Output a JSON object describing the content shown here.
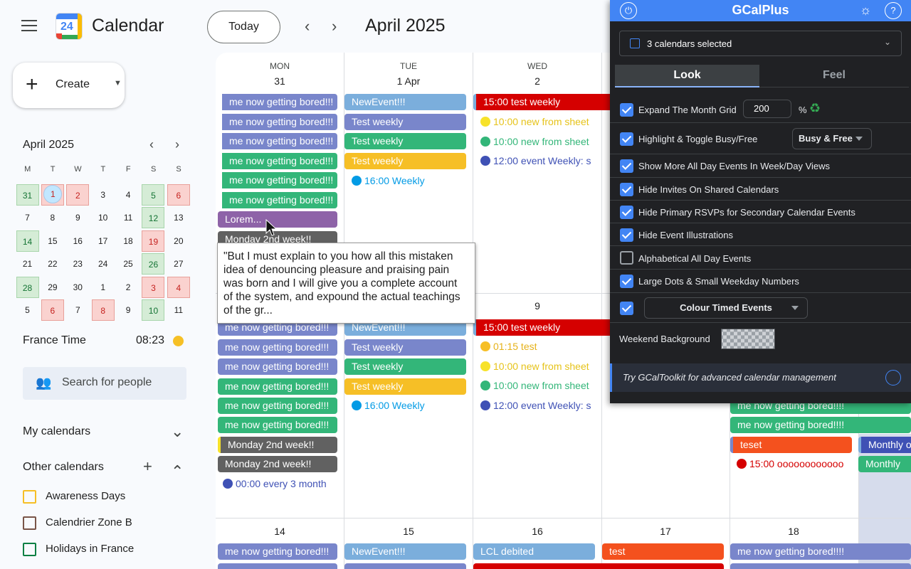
{
  "header": {
    "app_title": "Calendar",
    "logo_number": "24",
    "today_label": "Today",
    "month_title": "April 2025"
  },
  "sidebar": {
    "create_label": "Create",
    "mini_month": "April 2025",
    "dow": [
      "M",
      "T",
      "W",
      "T",
      "F",
      "S",
      "S"
    ],
    "weeks": [
      [
        "31",
        "1",
        "2",
        "3",
        "4",
        "5",
        "6"
      ],
      [
        "7",
        "8",
        "9",
        "10",
        "11",
        "12",
        "13"
      ],
      [
        "14",
        "15",
        "16",
        "17",
        "18",
        "19",
        "20"
      ],
      [
        "21",
        "22",
        "23",
        "24",
        "25",
        "26",
        "27"
      ],
      [
        "28",
        "29",
        "30",
        "1",
        "2",
        "3",
        "4"
      ],
      [
        "5",
        "6",
        "7",
        "8",
        "9",
        "10",
        "11"
      ]
    ],
    "tz_label": "France Time",
    "tz_time": "08:23",
    "search_placeholder": "Search for people",
    "my_calendars": "My calendars",
    "other_calendars": "Other calendars",
    "calendars": [
      "Awareness Days",
      "Calendrier Zone B",
      "Holidays in France"
    ]
  },
  "grid": {
    "dow": [
      "MON",
      "TUE",
      "WED"
    ],
    "week1_dates": [
      "31",
      "1 Apr",
      "2"
    ],
    "week2_dates": [
      "9"
    ],
    "week3_dates": [
      "14",
      "15",
      "16",
      "17",
      "18"
    ]
  },
  "events": {
    "mon_w1": [
      "me now getting bored!!!",
      "me now getting bored!!!",
      "me now getting bored!!!",
      "me now getting bored!!!",
      "me now getting bored!!!",
      "me now getting bored!!!",
      "Lorem...",
      "Monday 2nd week!!"
    ],
    "tue_w1": [
      "NewEvent!!!",
      "Test weekly",
      "Test weekly",
      "Test weekly"
    ],
    "tue_w1_timed": "16:00 Weekly",
    "wed_w1_allday": "15:00 test weekly",
    "wed_w1_timed": [
      "10:00 new from sheet",
      "10:00 new from sheet",
      "12:00 event Weekly: s"
    ],
    "mon_w2": [
      "me now getting bored!!!",
      "me now getting bored!!!",
      "me now getting bored!!!",
      "me now getting bored!!!",
      "me now getting bored!!!",
      "me now getting bored!!!",
      "Monday 2nd week!!",
      "Monday 2nd week!!"
    ],
    "mon_w2_timed": "00:00 every 3 month",
    "tue_w2": [
      "NewEvent!!!",
      "Test weekly",
      "Test weekly",
      "Test weekly"
    ],
    "tue_w2_timed": "16:00 Weekly",
    "wed_w2_allday": "15:00 test weekly",
    "wed_w2_timed": [
      "01:15 test",
      "10:00 new from sheet",
      "10:00 new from sheet",
      "12:00 event Weekly: s"
    ],
    "fri_w2": [
      "me now getting bored!!!!",
      "me now getting bored!!!!",
      "teset"
    ],
    "fri_w2_timed": "15:00 oooooooooooo",
    "sat_w2": [
      "Monthly o",
      "Monthly"
    ],
    "w3": {
      "mon": "me now getting bored!!!",
      "tue": "NewEvent!!!",
      "wed": "LCL debited",
      "thu": "test",
      "fri": "me now getting bored!!!!"
    }
  },
  "tooltip": "\"But I must explain to you how all this mistaken idea of denouncing pleasure and praising pain was born and I will give you a complete account of the system, and expound the actual teachings of the gr...",
  "panel": {
    "title": "GCalPlus",
    "calendars_selected": "3 calendars selected",
    "tabs": [
      "Look",
      "Feel"
    ],
    "expand_label": "Expand The Month Grid",
    "expand_value": "200",
    "percent": "%",
    "options": [
      {
        "label": "Highlight & Toggle Busy/Free",
        "checked": true
      },
      {
        "label": "Show More All Day Events In Week/Day Views",
        "checked": true
      },
      {
        "label": "Hide Invites On Shared Calendars",
        "checked": true
      },
      {
        "label": "Hide Primary RSVPs for Secondary Calendar Events",
        "checked": true
      },
      {
        "label": "Hide Event Illustrations",
        "checked": true
      },
      {
        "label": "Alphabetical All Day Events",
        "checked": false
      },
      {
        "label": "Large Dots & Small Weekday Numbers",
        "checked": true
      }
    ],
    "busy_free_select": "Busy & Free",
    "colour_timed_select": "Colour Timed Events",
    "weekend_bg_label": "Weekend Background",
    "promo": "Try GCalToolkit for advanced calendar management"
  },
  "colors": {
    "lavender": "#7986cb",
    "sage": "#33b679",
    "banana": "#f6bf26",
    "peacock": "#039be5",
    "tomato": "#d50000",
    "grape": "#8e24aa",
    "graphite": "#616161",
    "tangerine": "#f4511e",
    "blueberry": "#3f51b5",
    "sky": "#7baedc",
    "accent": "#4285f4"
  }
}
